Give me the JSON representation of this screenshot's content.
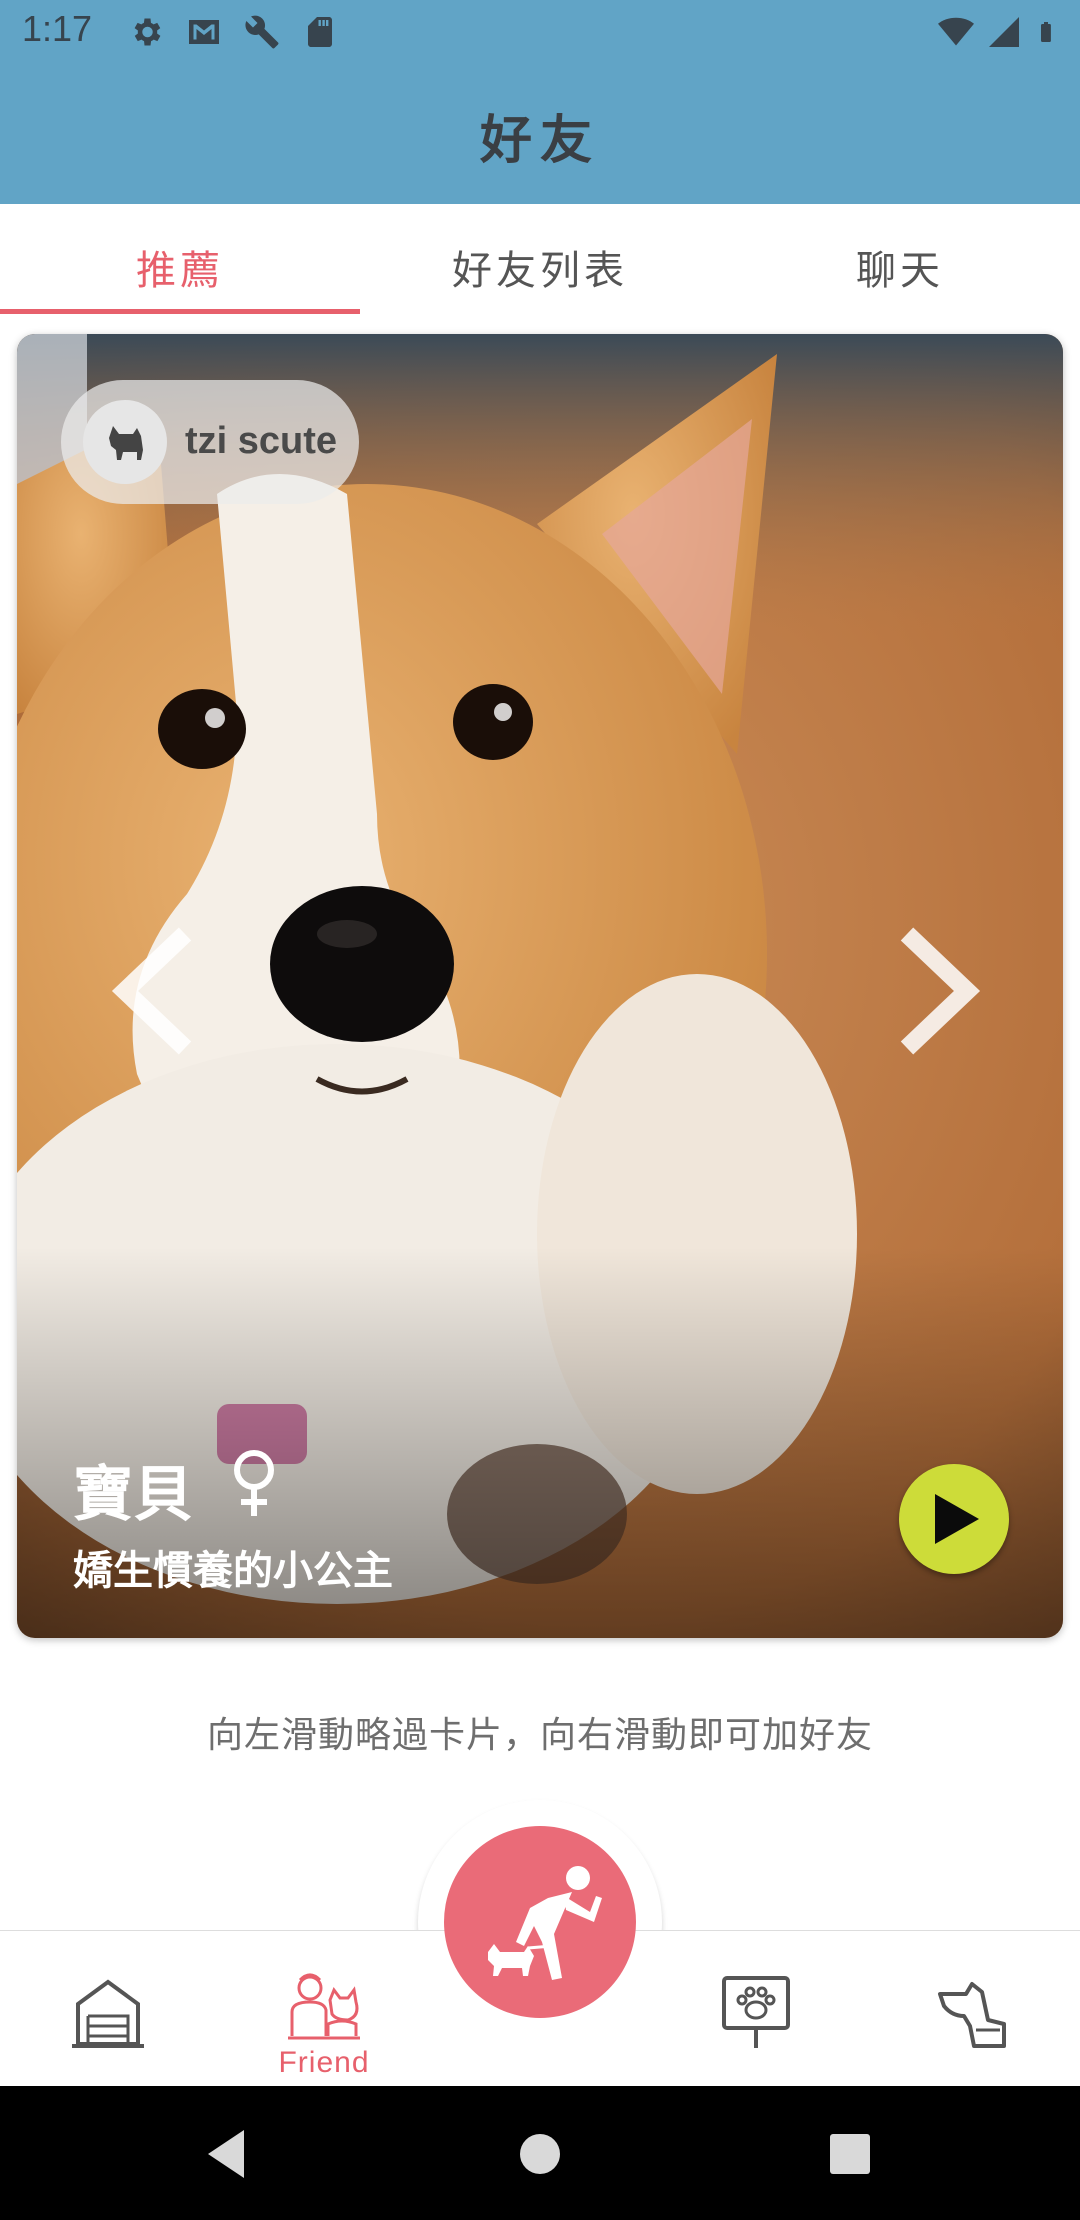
{
  "status_bar": {
    "time": "1:17",
    "left_icons": [
      "settings-icon",
      "gmail-icon",
      "wrench-icon",
      "sd-card-icon"
    ],
    "right_icons": [
      "wifi-icon",
      "signal-icon",
      "battery-icon"
    ]
  },
  "app_bar": {
    "title": "好友"
  },
  "tabs": [
    {
      "label": "推薦",
      "active": true
    },
    {
      "label": "好友列表",
      "active": false
    },
    {
      "label": "聊天",
      "active": false
    }
  ],
  "card": {
    "owner_name": "tzi scute",
    "pet_name": "寶貝",
    "gender": "female",
    "description": "嬌生慣養的小公主"
  },
  "hint": "向左滑動略過卡片，向右滑動即可加好友",
  "bottom_nav": {
    "items": [
      {
        "icon": "house-icon",
        "label": ""
      },
      {
        "icon": "friend-icon",
        "label": "Friend",
        "active": true
      },
      {
        "icon": "paw-sign-icon",
        "label": ""
      },
      {
        "icon": "dog-profile-icon",
        "label": ""
      }
    ],
    "fab_icon": "walking-dog-icon"
  },
  "colors": {
    "primary": "#61a4c6",
    "accent": "#e7606c",
    "play": "#cddc39"
  }
}
